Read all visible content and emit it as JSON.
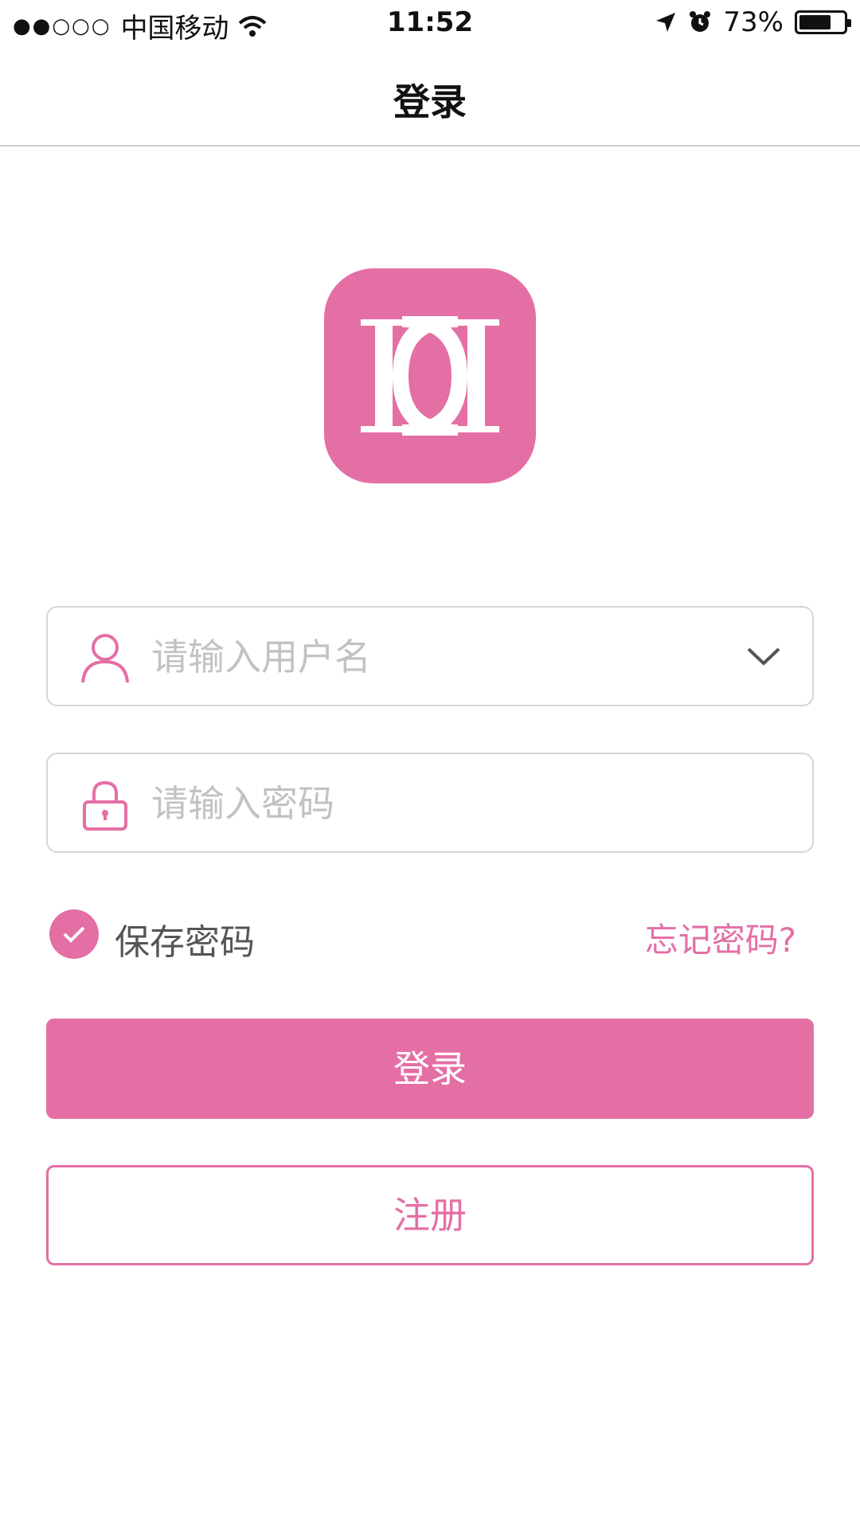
{
  "status_bar": {
    "signal": "●●○○○",
    "carrier": "中国移动",
    "time": "11:52",
    "battery_text": "73%",
    "battery_level": 0.73
  },
  "nav": {
    "title": "登录"
  },
  "form": {
    "username_placeholder": "请输入用户名",
    "password_placeholder": "请输入密码",
    "save_password_label": "保存密码",
    "forgot_password_label": "忘记密码?",
    "save_password_checked": true
  },
  "buttons": {
    "login_label": "登录",
    "register_label": "注册"
  },
  "colors": {
    "accent": "#e46fa5",
    "border": "#d6d6d6",
    "placeholder": "#c2c2c6"
  },
  "icons": {
    "logo": "dd-logo-icon",
    "user": "user-icon",
    "lock": "lock-icon",
    "dropdown": "chevron-down-icon",
    "check": "checkmark-icon"
  }
}
